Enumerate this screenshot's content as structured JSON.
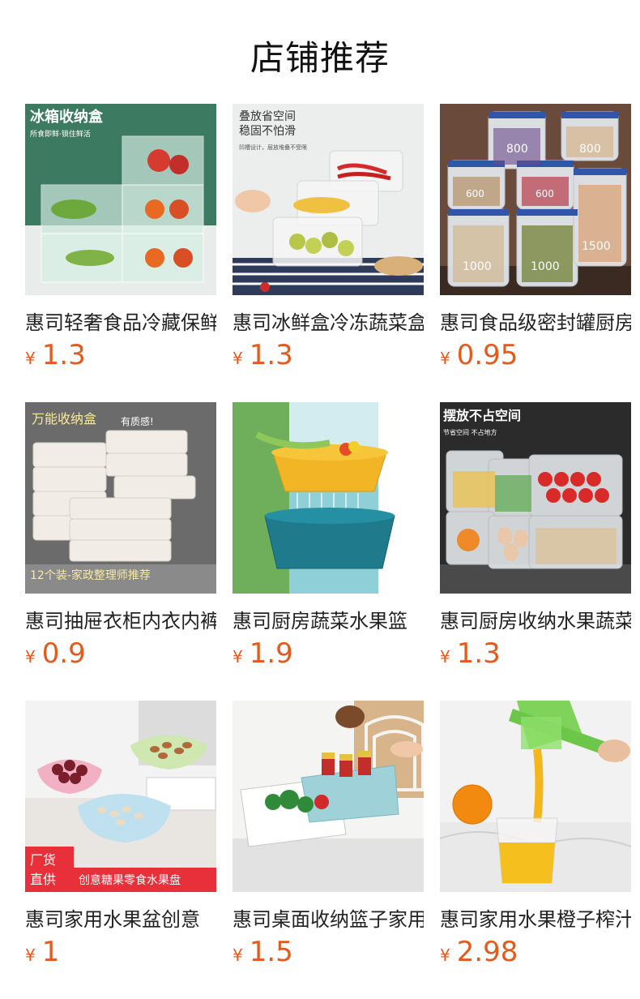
{
  "header": {
    "title": "店铺推荐"
  },
  "currency_symbol": "¥",
  "products": [
    {
      "name": "惠司轻奢食品冷藏保鲜盒",
      "price": "1.3",
      "image": {
        "overlay_title": "冰箱收纳盒",
        "overlay_sub": "所食即鲜·锁住鲜活"
      }
    },
    {
      "name": "惠司冰鲜盒冷冻蔬菜盒",
      "price": "1.3",
      "image": {
        "overlay_title": "叠放省空间",
        "overlay_title2": "稳固不怕滑",
        "overlay_sub": "凹槽设计，层放堆叠不受限"
      }
    },
    {
      "name": "惠司食品级密封罐厨房",
      "price": "0.95",
      "image": {
        "jar_labels": [
          "800",
          "800",
          "600",
          "600",
          "1000",
          "1000",
          "1500"
        ]
      }
    },
    {
      "name": "惠司抽屉衣柜内衣内裤收纳",
      "price": "0.9",
      "image": {
        "overlay_title": "万能收纳盒",
        "overlay_tag": "有质感!",
        "overlay_bottom": "12个装-家政整理师推荐"
      }
    },
    {
      "name": "惠司厨房蔬菜水果篮",
      "price": "1.9",
      "image": {}
    },
    {
      "name": "惠司厨房收纳水果蔬菜盒",
      "price": "1.3",
      "image": {
        "overlay_title": "摆放不占空间",
        "overlay_sub": "节省空间 不占地方"
      }
    },
    {
      "name": "惠司家用水果盆创意",
      "price": "1",
      "image": {
        "badge_line1": "厂货",
        "badge_line2": "直供",
        "overlay_bottom": "创意糖果零食水果盘"
      }
    },
    {
      "name": "惠司桌面收纳篮子家用",
      "price": "1.5",
      "image": {}
    },
    {
      "name": "惠司家用水果橙子榨汁器",
      "price": "2.98",
      "image": {}
    }
  ]
}
